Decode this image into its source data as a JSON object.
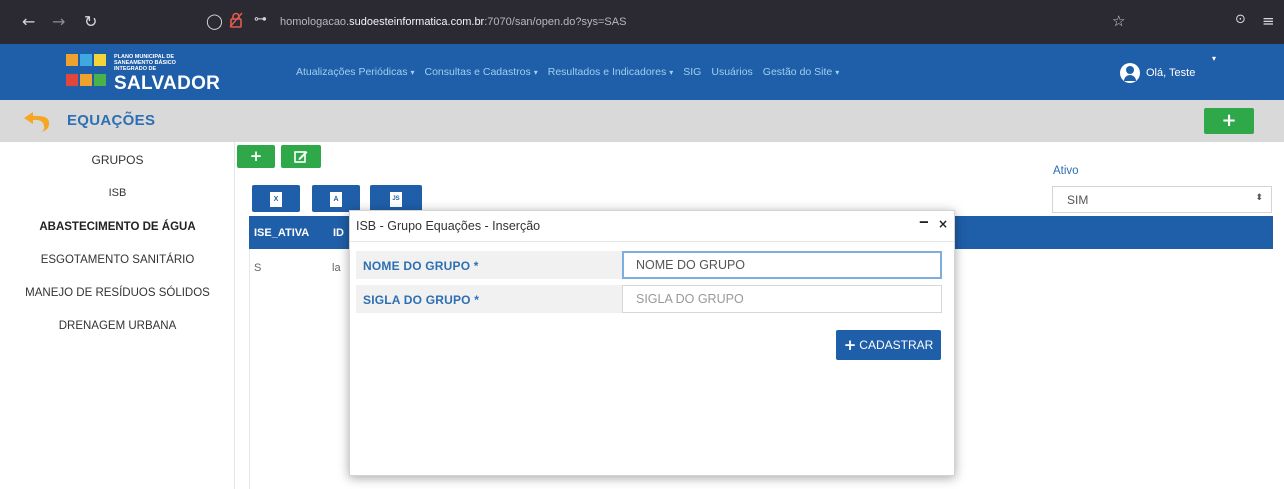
{
  "browser": {
    "url_prefix": "homologacao.",
    "url_domain": "sudoesteinformatica.com.br",
    "url_suffix": ":7070/san/open.do?sys=SAS",
    "icons": [
      "back-icon",
      "forward-icon",
      "reload-icon",
      "shield-icon",
      "lock-icon",
      "key-icon",
      "bookmark-star-icon",
      "pocket-icon",
      "menu-icon"
    ]
  },
  "header": {
    "logo_small": "PLANO MUNICIPAL DE SANEAMENTO BÁSICO INTEGRADO DE",
    "logo_big": "SALVADOR",
    "menu": [
      {
        "label": "Atualizações Periódicas",
        "caret": "▾"
      },
      {
        "label": "Consultas e Cadastros",
        "caret": "▾"
      },
      {
        "label": "Resultados e Indicadores",
        "caret": "▾"
      },
      {
        "label": "SIG",
        "caret": ""
      },
      {
        "label": "Usuários",
        "caret": ""
      },
      {
        "label": "Gestão do Site",
        "caret": "▾"
      }
    ],
    "user_greeting": "Olá, Teste",
    "colors": {
      "bar": "#1f5ea8",
      "menu_text": "#9fd0ee"
    }
  },
  "page": {
    "title": "EQUAÇÕES",
    "add_button": "+"
  },
  "sidebar": {
    "items": [
      {
        "label": "GRUPOS",
        "bold": false
      },
      {
        "label": "ISB",
        "bold": false
      },
      {
        "label": "ABASTECIMENTO DE ÁGUA",
        "bold": true
      },
      {
        "label": "ESGOTAMENTO SANITÁRIO",
        "bold": false
      },
      {
        "label": "MANEJO DE RESÍDUOS SÓLIDOS",
        "bold": false
      },
      {
        "label": "DRENAGEM URBANA",
        "bold": false
      }
    ]
  },
  "toolbar": {
    "add": "+",
    "edit_icon": "edit-icon",
    "exports": [
      {
        "name": "excel-export",
        "glyph": "X"
      },
      {
        "name": "pdf-export",
        "glyph": "A"
      },
      {
        "name": "json-export",
        "glyph": "JS"
      }
    ]
  },
  "filter": {
    "label": "Ativo",
    "value": "SIM"
  },
  "table": {
    "columns": [
      "ISE_ATIVA",
      "ID"
    ],
    "rows": [
      [
        "S",
        "la"
      ]
    ]
  },
  "modal": {
    "title": "ISB - Grupo Equações - Inserção",
    "minimize": "‒",
    "close": "×",
    "fields": [
      {
        "label": "NOME DO GRUPO *",
        "placeholder": "NOME DO GRUPO",
        "value": ""
      },
      {
        "label": "SIGLA DO GRUPO *",
        "placeholder": "SIGLA DO GRUPO",
        "value": ""
      }
    ],
    "submit": "CADASTRAR"
  }
}
